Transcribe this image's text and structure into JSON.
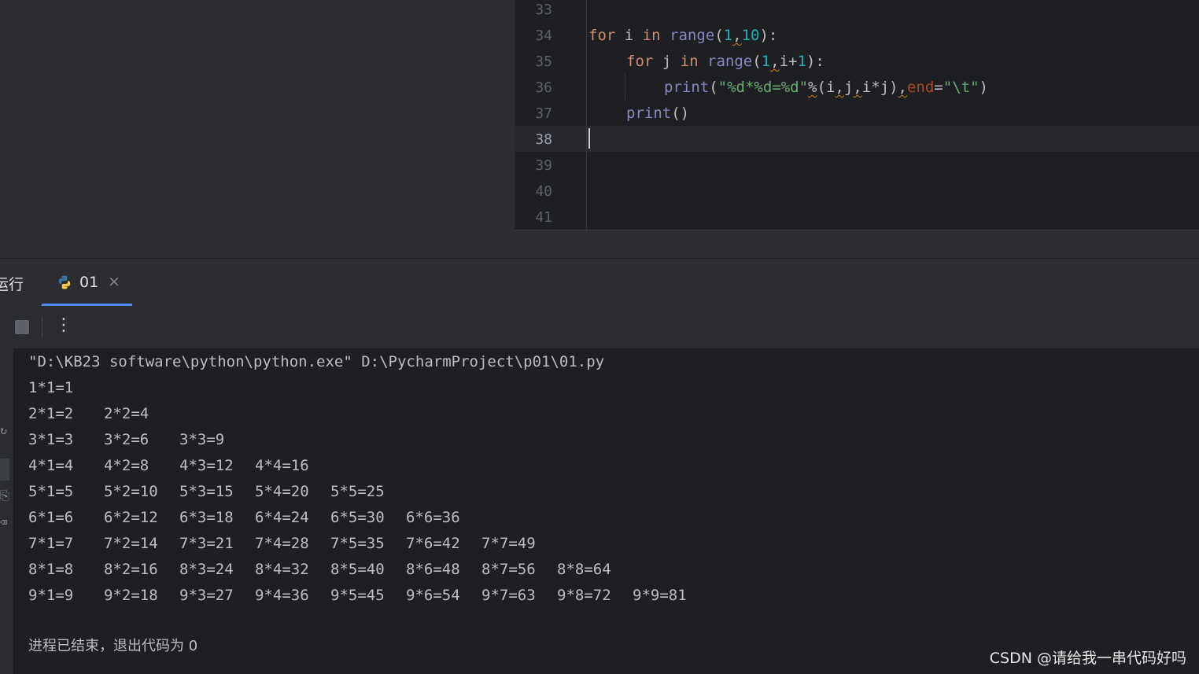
{
  "editor": {
    "line_numbers": [
      "33",
      "34",
      "35",
      "36",
      "37",
      "38",
      "39",
      "40",
      "41"
    ],
    "current_line": "38",
    "code": {
      "l34": {
        "kw_for": "for",
        "var": " i ",
        "kw_in": "in",
        "sp": " ",
        "fn": "range",
        "p1": "(",
        "n1": "1",
        "c1": ",",
        "n2": "10",
        "p2": "):"
      },
      "l35": {
        "kw_for": "for",
        "var": " j ",
        "kw_in": "in",
        "sp": " ",
        "fn": "range",
        "p1": "(",
        "n1": "1",
        "c1": ",",
        "v": "i+",
        "n2": "1",
        "p2": "):"
      },
      "l36": {
        "fn": "print",
        "p1": "(",
        "str": "\"%d*%d=%d\"",
        "pct": "%",
        "args1": "(i",
        "c1": ",",
        "args2": "j",
        "c2": ",",
        "args3": "i*j)",
        "c3": ",",
        "param": "end",
        "eq": "=",
        "str2": "\"\\t\"",
        "p2": ")"
      },
      "l37": {
        "fn": "print",
        "p": "()"
      }
    }
  },
  "run_panel": {
    "title": "运行",
    "tab_label": "01",
    "close_glyph": "×",
    "more_glyph": "⋮"
  },
  "console": {
    "command": "\"D:\\KB23 software\\python\\python.exe\" D:\\PycharmProject\\p01\\01.py",
    "rows": [
      [
        "1*1=1"
      ],
      [
        "2*1=2",
        "2*2=4"
      ],
      [
        "3*1=3",
        "3*2=6",
        "3*3=9"
      ],
      [
        "4*1=4",
        "4*2=8",
        "4*3=12",
        "4*4=16"
      ],
      [
        "5*1=5",
        "5*2=10",
        "5*3=15",
        "5*4=20",
        "5*5=25"
      ],
      [
        "6*1=6",
        "6*2=12",
        "6*3=18",
        "6*4=24",
        "6*5=30",
        "6*6=36"
      ],
      [
        "7*1=7",
        "7*2=14",
        "7*3=21",
        "7*4=28",
        "7*5=35",
        "7*6=42",
        "7*7=49"
      ],
      [
        "8*1=8",
        "8*2=16",
        "8*3=24",
        "8*4=32",
        "8*5=40",
        "8*6=48",
        "8*7=56",
        "8*8=64"
      ],
      [
        "9*1=9",
        "9*2=18",
        "9*3=27",
        "9*4=36",
        "9*5=45",
        "9*6=54",
        "9*7=63",
        "9*8=72",
        "9*9=81"
      ]
    ],
    "exit_message": "进程已结束，退出代码为 0"
  },
  "watermark": "CSDN @请给我一串代码好吗",
  "colors": {
    "keyword": "#cf8e6d",
    "string": "#6aab73",
    "number": "#2aacb8",
    "accent": "#548af7"
  }
}
